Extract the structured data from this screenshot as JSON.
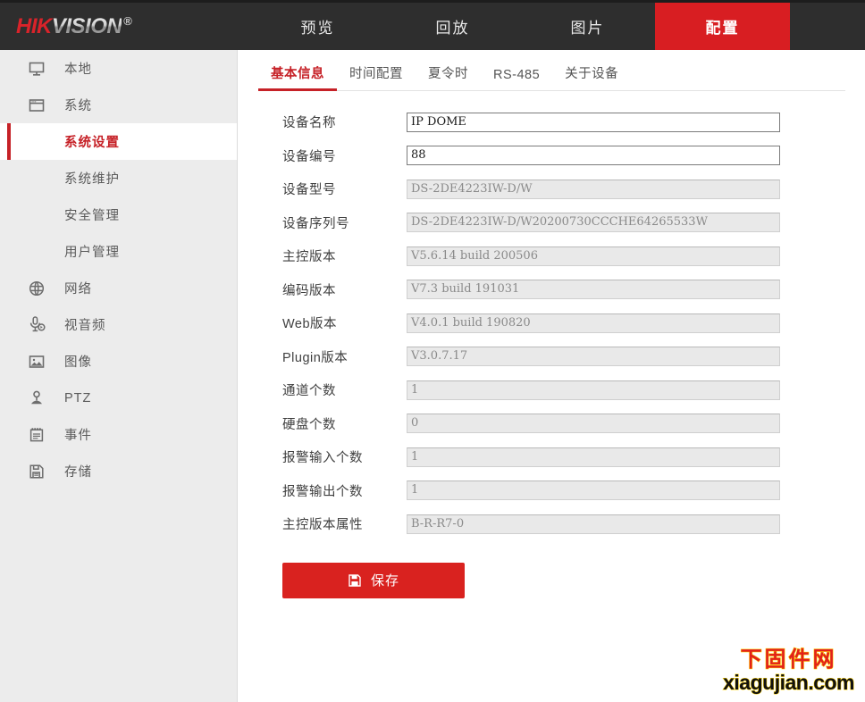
{
  "header": {
    "logo": {
      "part1": "HIK",
      "part2": "VISION",
      "reg": "®"
    },
    "nav": [
      {
        "label": "预览",
        "name": "nav-preview",
        "active": false
      },
      {
        "label": "回放",
        "name": "nav-playback",
        "active": false
      },
      {
        "label": "图片",
        "name": "nav-picture",
        "active": false
      },
      {
        "label": "配置",
        "name": "nav-config",
        "active": true
      }
    ],
    "accent_color": "#d81e22",
    "bar_color": "#2e2e2e"
  },
  "sidebar": {
    "items": [
      {
        "label": "本地",
        "icon": "monitor-icon",
        "name": "sidebar-item-local",
        "active": false,
        "sub": false
      },
      {
        "label": "系统",
        "icon": "window-icon",
        "name": "sidebar-item-system",
        "active": false,
        "sub": false
      },
      {
        "label": "系统设置",
        "icon": "",
        "name": "sidebar-item-system-settings",
        "active": true,
        "sub": true
      },
      {
        "label": "系统维护",
        "icon": "",
        "name": "sidebar-item-system-maintenance",
        "active": false,
        "sub": true
      },
      {
        "label": "安全管理",
        "icon": "",
        "name": "sidebar-item-security-management",
        "active": false,
        "sub": true
      },
      {
        "label": "用户管理",
        "icon": "",
        "name": "sidebar-item-user-management",
        "active": false,
        "sub": true
      },
      {
        "label": "网络",
        "icon": "globe-icon",
        "name": "sidebar-item-network",
        "active": false,
        "sub": false
      },
      {
        "label": "视音频",
        "icon": "microphone-icon",
        "name": "sidebar-item-video-audio",
        "active": false,
        "sub": false
      },
      {
        "label": "图像",
        "icon": "image-icon",
        "name": "sidebar-item-image",
        "active": false,
        "sub": false
      },
      {
        "label": "PTZ",
        "icon": "ptz-icon",
        "name": "sidebar-item-ptz",
        "active": false,
        "sub": false
      },
      {
        "label": "事件",
        "icon": "notepad-icon",
        "name": "sidebar-item-event",
        "active": false,
        "sub": false
      },
      {
        "label": "存储",
        "icon": "floppy-icon",
        "name": "sidebar-item-storage",
        "active": false,
        "sub": false
      }
    ],
    "active_color": "#c62127"
  },
  "main": {
    "tabs": [
      {
        "label": "基本信息",
        "name": "tab-basic-info",
        "active": true
      },
      {
        "label": "时间配置",
        "name": "tab-time-settings",
        "active": false
      },
      {
        "label": "夏令时",
        "name": "tab-dst",
        "active": false
      },
      {
        "label": "RS-485",
        "name": "tab-rs485",
        "active": false
      },
      {
        "label": "关于设备",
        "name": "tab-about-device",
        "active": false
      }
    ],
    "fields": [
      {
        "label": "设备名称",
        "value": "IP DOME",
        "readonly": false,
        "name": "field-device-name"
      },
      {
        "label": "设备编号",
        "value": "88",
        "readonly": false,
        "name": "field-device-no"
      },
      {
        "label": "设备型号",
        "value": "DS-2DE4223IW-D/W",
        "readonly": true,
        "name": "field-device-model"
      },
      {
        "label": "设备序列号",
        "value": "DS-2DE4223IW-D/W20200730CCCHE64265533W",
        "readonly": true,
        "name": "field-device-serial"
      },
      {
        "label": "主控版本",
        "value": "V5.6.14 build 200506",
        "readonly": true,
        "name": "field-firmware-version"
      },
      {
        "label": "编码版本",
        "value": "V7.3 build 191031",
        "readonly": true,
        "name": "field-encoding-version"
      },
      {
        "label": "Web版本",
        "value": "V4.0.1 build 190820",
        "readonly": true,
        "name": "field-web-version"
      },
      {
        "label": "Plugin版本",
        "value": "V3.0.7.17",
        "readonly": true,
        "name": "field-plugin-version"
      },
      {
        "label": "通道个数",
        "value": "1",
        "readonly": true,
        "name": "field-channel-count"
      },
      {
        "label": "硬盘个数",
        "value": "0",
        "readonly": true,
        "name": "field-hdd-count"
      },
      {
        "label": "报警输入个数",
        "value": "1",
        "readonly": true,
        "name": "field-alarm-in-count"
      },
      {
        "label": "报警输出个数",
        "value": "1",
        "readonly": true,
        "name": "field-alarm-out-count"
      },
      {
        "label": "主控版本属性",
        "value": "B-R-R7-0",
        "readonly": true,
        "name": "field-firmware-attr"
      }
    ],
    "save_label": "保存",
    "save_color": "#d9221f"
  },
  "watermark": {
    "cn": "下固件网",
    "en": "xiagujian.com",
    "cn_color": "#e2211c",
    "outline_color": "#ffd400"
  }
}
